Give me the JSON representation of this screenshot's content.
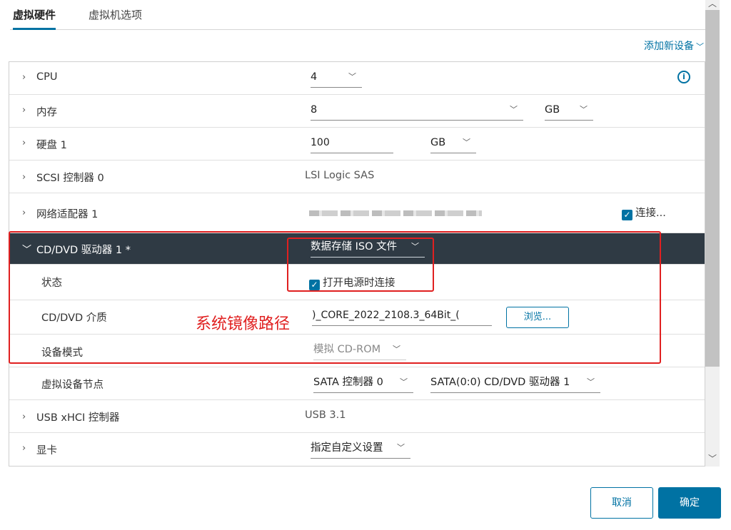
{
  "tabs": [
    {
      "label": "虚拟硬件"
    },
    {
      "label": "虚拟机选项"
    }
  ],
  "add_device": {
    "label": "添加新设备"
  },
  "rows": {
    "cpu": {
      "label": "CPU",
      "value": "4"
    },
    "memory": {
      "label": "内存",
      "value": "8",
      "unit": "GB"
    },
    "disk": {
      "label": "硬盘 1",
      "value": "100",
      "unit": "GB"
    },
    "scsi": {
      "label": "SCSI 控制器 0",
      "value": "LSI Logic SAS"
    },
    "network": {
      "label": "网络适配器 1",
      "connect_label": "连接..."
    },
    "cdrom": {
      "label": "CD/DVD 驱动器 1 *",
      "value": "数据存储 ISO 文件"
    },
    "status": {
      "label": "状态",
      "checkbox_label": "打开电源时连接"
    },
    "media": {
      "label": "CD/DVD 介质",
      "value": ")_CORE_2022_2108.3_64Bit_(",
      "browse_label": "浏览..."
    },
    "device_mode": {
      "label": "设备模式",
      "value": "模拟 CD-ROM"
    },
    "vdn": {
      "label": "虚拟设备节点",
      "controller": "SATA 控制器 0",
      "node": "SATA(0:0) CD/DVD 驱动器 1"
    },
    "usb": {
      "label": "USB xHCI 控制器",
      "value": "USB 3.1"
    },
    "gpu": {
      "label": "显卡",
      "value": "指定自定义设置"
    }
  },
  "annotation": {
    "text": "系统镜像路径"
  },
  "footer": {
    "cancel_label": "取消",
    "ok_label": "确定"
  },
  "colors": {
    "accent": "#0072a3",
    "header_dark": "#2f3a44",
    "annotation_red": "#e02020"
  }
}
